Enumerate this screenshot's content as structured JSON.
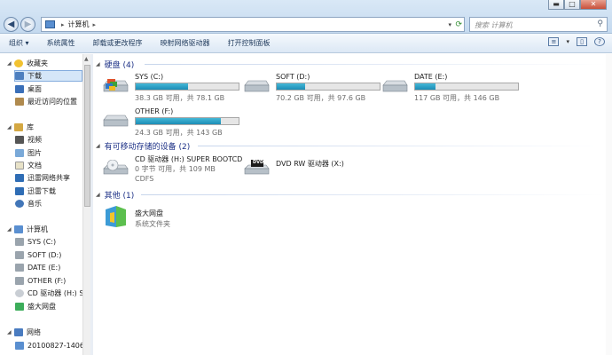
{
  "window": {
    "minimize": "▬",
    "maximize": "□",
    "close": "✕"
  },
  "address": {
    "path": "计算机",
    "chevron": "▸"
  },
  "search": {
    "placeholder": "搜索 计算机"
  },
  "toolbar": {
    "organize": "组织 ▾",
    "system_properties": "系统属性",
    "uninstall": "卸载或更改程序",
    "map_drive": "映射网络驱动器",
    "control_panel": "打开控制面板"
  },
  "nav": {
    "favorites": "收藏夹",
    "downloads": "下载",
    "desktop": "桌面",
    "recent": "最近访问的位置",
    "libraries": "库",
    "videos": "视频",
    "pictures": "图片",
    "documents": "文档",
    "thunder_share": "迅雷网络共享",
    "thunder_download": "迅雷下载",
    "music": "音乐",
    "computer": "计算机",
    "sys": "SYS (C:)",
    "soft": "SOFT (D:)",
    "date": "DATE (E:)",
    "other": "OTHER (F:)",
    "cd": "CD 驱动器 (H:) S",
    "shengda": "盛大网盘",
    "network": "网络",
    "net_host": "20100827-1406"
  },
  "groups": {
    "hdd": "硬盘 (4)",
    "removable": "有可移动存储的设备 (2)",
    "other": "其他 (1)"
  },
  "drives": [
    {
      "name": "SYS (C:)",
      "free": "38.3 GB 可用，共 78.1 GB",
      "used_fraction": 0.51
    },
    {
      "name": "SOFT (D:)",
      "free": "70.2 GB 可用，共 97.6 GB",
      "used_fraction": 0.28
    },
    {
      "name": "DATE (E:)",
      "free": "117 GB 可用，共 146 GB",
      "used_fraction": 0.2
    },
    {
      "name": "OTHER (F:)",
      "free": "24.3 GB 可用，共 143 GB",
      "used_fraction": 0.83
    }
  ],
  "removable": [
    {
      "name": "CD 驱动器 (H:) SUPER BOOTCD",
      "free": "0 字节 可用，共 109 MB",
      "fs": "CDFS"
    },
    {
      "name": "DVD RW 驱动器 (X:)",
      "logo": "DVD"
    }
  ],
  "other_items": [
    {
      "name": "盛大网盘",
      "desc": "系统文件夹"
    }
  ],
  "colors": {
    "group_header": "#1e3287",
    "bar_fill": "#26a0c8"
  }
}
